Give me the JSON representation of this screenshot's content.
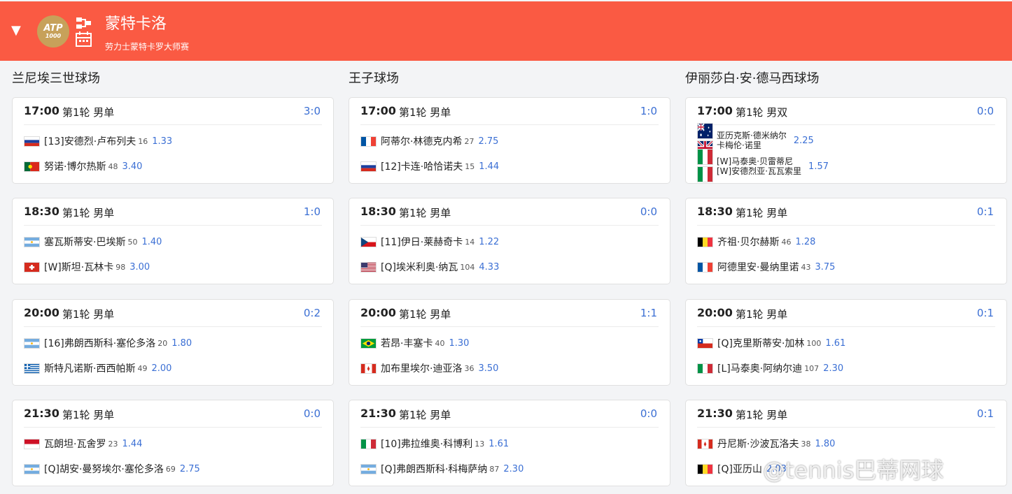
{
  "tournament": {
    "logo_line1": "ATP",
    "logo_line2": "1000",
    "title": "蒙特卡洛",
    "subtitle": "劳力士蒙特卡罗大师赛"
  },
  "watermark": "@tennis巴蒂网球",
  "courts": [
    {
      "name": "兰尼埃三世球场",
      "matches": [
        {
          "time": "17:00",
          "round": "第1轮 男单",
          "score": "3:0",
          "players": [
            {
              "flag": "russia",
              "name": "[13]安德烈·卢布列夫",
              "rank": "16",
              "odds": "1.33"
            },
            {
              "flag": "portugal",
              "name": "努诺·博尔热斯",
              "rank": "48",
              "odds": "3.40"
            }
          ]
        },
        {
          "time": "18:30",
          "round": "第1轮 男单",
          "score": "1:0",
          "players": [
            {
              "flag": "argentina",
              "name": "塞瓦斯蒂安·巴埃斯",
              "rank": "50",
              "odds": "1.40"
            },
            {
              "flag": "switzerland",
              "name": "[W]斯坦·瓦林卡",
              "rank": "98",
              "odds": "3.00"
            }
          ]
        },
        {
          "time": "20:00",
          "round": "第1轮 男单",
          "score": "0:2",
          "players": [
            {
              "flag": "argentina",
              "name": "[16]弗朗西斯科·塞伦多洛",
              "rank": "20",
              "odds": "1.80"
            },
            {
              "flag": "greece",
              "name": "斯特凡诺斯·西西帕斯",
              "rank": "49",
              "odds": "2.00"
            }
          ]
        },
        {
          "time": "21:30",
          "round": "第1轮 男单",
          "score": "0:0",
          "players": [
            {
              "flag": "monaco",
              "name": "瓦朗坦·瓦舍罗",
              "rank": "23",
              "odds": "1.44"
            },
            {
              "flag": "argentina",
              "name": "[Q]胡安·曼努埃尔·塞伦多洛",
              "rank": "69",
              "odds": "2.75"
            }
          ]
        }
      ]
    },
    {
      "name": "王子球场",
      "matches": [
        {
          "time": "17:00",
          "round": "第1轮 男单",
          "score": "1:0",
          "players": [
            {
              "flag": "france",
              "name": "阿蒂尔·林德克内希",
              "rank": "27",
              "odds": "2.75"
            },
            {
              "flag": "russia",
              "name": "[12]卡连·哈恰诺夫",
              "rank": "15",
              "odds": "1.44"
            }
          ]
        },
        {
          "time": "18:30",
          "round": "第1轮 男单",
          "score": "0:0",
          "players": [
            {
              "flag": "czech",
              "name": "[11]伊日·莱赫奇卡",
              "rank": "14",
              "odds": "1.22"
            },
            {
              "flag": "usa",
              "name": "[Q]埃米利奥·纳瓦",
              "rank": "104",
              "odds": "4.33"
            }
          ]
        },
        {
          "time": "20:00",
          "round": "第1轮 男单",
          "score": "1:1",
          "players": [
            {
              "flag": "brazil",
              "name": "若昂·丰塞卡",
              "rank": "40",
              "odds": "1.30"
            },
            {
              "flag": "canada",
              "name": "加布里埃尔·迪亚洛",
              "rank": "36",
              "odds": "3.50"
            }
          ]
        },
        {
          "time": "21:30",
          "round": "第1轮 男单",
          "score": "0:0",
          "players": [
            {
              "flag": "italy",
              "name": "[10]弗拉维奥·科博利",
              "rank": "13",
              "odds": "1.61"
            },
            {
              "flag": "argentina",
              "name": "[Q]弗朗西斯科·科梅萨纳",
              "rank": "87",
              "odds": "2.30"
            }
          ]
        }
      ]
    },
    {
      "name": "伊丽莎白·安·德马西球场",
      "matches": [
        {
          "time": "17:00",
          "round": "第1轮 男双",
          "score": "0:0",
          "teams": [
            {
              "flags": [
                "australia",
                "uk"
              ],
              "names": [
                "亚历克斯·德米纳尔",
                "卡梅伦·诺里"
              ],
              "odds": "2.25"
            },
            {
              "flags": [
                "italy",
                "italy"
              ],
              "names": [
                "[W]马泰奥·贝雷蒂尼",
                "[W]安德烈亚·瓦瓦索里"
              ],
              "odds": "1.57"
            }
          ]
        },
        {
          "time": "18:30",
          "round": "第1轮 男单",
          "score": "0:1",
          "players": [
            {
              "flag": "belgium",
              "name": "齐祖·贝尔赫斯",
              "rank": "46",
              "odds": "1.28"
            },
            {
              "flag": "france",
              "name": "阿德里安·曼纳里诺",
              "rank": "43",
              "odds": "3.75"
            }
          ]
        },
        {
          "time": "20:00",
          "round": "第1轮 男单",
          "score": "0:1",
          "players": [
            {
              "flag": "chile",
              "name": "[Q]克里斯蒂安·加林",
              "rank": "100",
              "odds": "1.61"
            },
            {
              "flag": "italy",
              "name": "[L]马泰奥·阿纳尔迪",
              "rank": "107",
              "odds": "2.30"
            }
          ]
        },
        {
          "time": "21:30",
          "round": "第1轮 男单",
          "score": "0:1",
          "players": [
            {
              "flag": "canada",
              "name": "丹尼斯·沙波瓦洛夫",
              "rank": "38",
              "odds": "1.80"
            },
            {
              "flag": "belgium",
              "name": "[Q]亚历山",
              "rank": "",
              "odds": "2.03"
            }
          ]
        }
      ]
    }
  ]
}
